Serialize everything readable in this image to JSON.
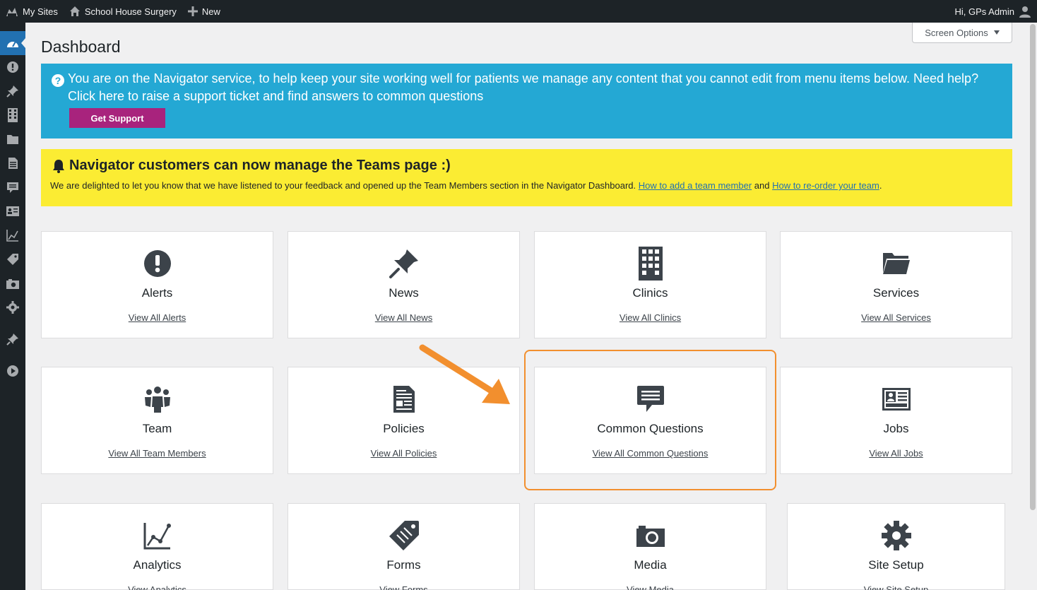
{
  "adminbar": {
    "my_sites": "My Sites",
    "site_name": "School House Surgery",
    "new": "New",
    "greeting": "Hi, GPs Admin",
    "icons": [
      "wordpress-icon",
      "home-icon",
      "plus-icon",
      "user-avatar-icon"
    ]
  },
  "sidebar": {
    "items": [
      {
        "icon": "dashboard-icon",
        "active": true
      },
      {
        "icon": "alert-icon"
      },
      {
        "icon": "pushpin-icon"
      },
      {
        "icon": "building-icon"
      },
      {
        "icon": "folder-icon"
      },
      {
        "icon": "document-icon"
      },
      {
        "icon": "comment-icon"
      },
      {
        "icon": "id-card-icon"
      },
      {
        "icon": "analytics-icon"
      },
      {
        "icon": "tag-icon"
      },
      {
        "icon": "camera-icon"
      },
      {
        "icon": "gear-icon"
      },
      {
        "icon": "pushpin-icon"
      },
      {
        "icon": "play-circle-icon"
      }
    ]
  },
  "screen_options": "Screen Options",
  "page_title": "Dashboard",
  "notice_blue": {
    "text": "You are on the Navigator service, to help keep your site working well for patients we manage any content that you cannot edit from menu items below. Need help? Click here to raise a support ticket and find answers to common questions",
    "button": "Get Support",
    "color": "#24a8d4"
  },
  "notice_yellow": {
    "heading": "Navigator customers can now manage the Teams page :)",
    "body_before": "We are delighted to let you know that we have listened to your feedback and opened up the Team Members section in the Navigator Dashboard. ",
    "link1": "How to add a team member",
    "body_middle": " and ",
    "link2": "How to re-order your team",
    "body_after": ".",
    "color": "#fbec33"
  },
  "cards": [
    {
      "title": "Alerts",
      "link": "View All Alerts",
      "icon": "alert-icon"
    },
    {
      "title": "News",
      "link": "View All News",
      "icon": "pushpin-icon"
    },
    {
      "title": "Clinics",
      "link": "View All Clinics",
      "icon": "building-icon"
    },
    {
      "title": "Services",
      "link": "View All Services",
      "icon": "folder-icon"
    },
    {
      "title": "Team",
      "link": "View All Team Members",
      "icon": "groups-icon"
    },
    {
      "title": "Policies",
      "link": "View All Policies",
      "icon": "document-icon"
    },
    {
      "title": "Common Questions",
      "link": "View All Common Questions",
      "icon": "comment-icon"
    },
    {
      "title": "Jobs",
      "link": "View All Jobs",
      "icon": "id-card-icon"
    },
    {
      "title": "Analytics",
      "link": "View Analytics",
      "icon": "analytics-icon"
    },
    {
      "title": "Forms",
      "link": "View Forms",
      "icon": "tag-icon"
    },
    {
      "title": "Media",
      "link": "View Media",
      "icon": "camera-icon"
    },
    {
      "title": "Site Setup",
      "link": "View Site Setup",
      "icon": "gear-icon"
    }
  ],
  "accent_colors": {
    "highlight": "#f28f2e",
    "button": "#a8237d",
    "link": "#2271b1"
  }
}
